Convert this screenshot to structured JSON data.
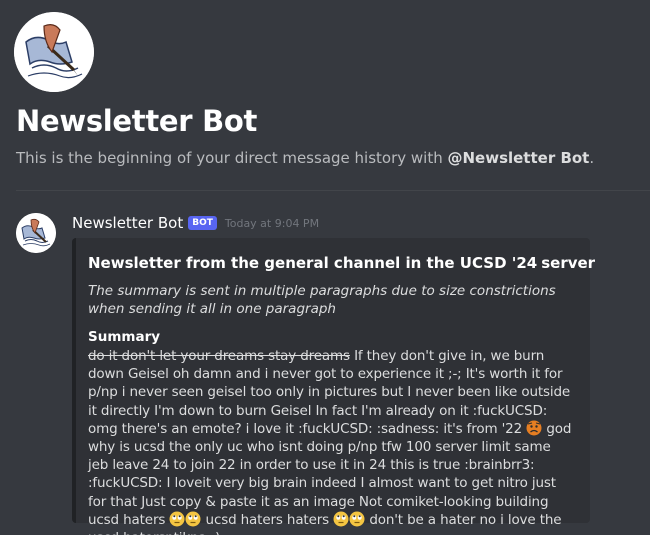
{
  "hero": {
    "title": "Newsletter Bot",
    "subtitle_prefix": "This is the beginning of your direct message history with ",
    "mention": "@Newsletter Bot",
    "subtitle_suffix": "."
  },
  "message": {
    "author": "Newsletter Bot",
    "tag": "BOT",
    "timestamp": "Today at 9:04 PM"
  },
  "embed": {
    "title_prefix": "Newsletter from the general channel in the UCSD '24",
    "title_suffix": "server",
    "description": "The summary is sent in multiple paragraphs due to size constrictions when sending it all in one paragraph",
    "field_name": "Summary",
    "summary": {
      "strikethrough": "do it don't let your dreams stay dreams",
      "part1": " If they don't give in, we burn down Geisel oh damn and i never got to experience it ;-; It's worth it for p/np i never seen geisel too only in pictures but I never been like outside it directly I'm down to burn Geisel In fact I'm already on it :fuckUCSD: omg there's an emote? i love it :fuckUCSD: :sadness: it's from '22 ",
      "part2": " god why is ucsd the only uc who isnt doing p/np tfw 100 server limit same jeb leave 24 to join 22 in order to use it in 24 this is true :brainbrr3: :fuckUCSD: I loveit very big brain indeed I almost want to get nitro just for that Just copy & paste it as an image Not comiket-looking building ucsd haters ",
      "part3": " ucsd haters haters ",
      "part4": " don't be a hater no i love the uscd hatersntjkna: )_"
    }
  },
  "icons": {
    "avatar": "quill-pen-avatar-icon",
    "trident": "trident-emoji-icon",
    "rainbow": "rainbow-emoji-icon",
    "sad": "sad-face-emoji-icon",
    "eyeroll": "eye-roll-emoji-icon"
  }
}
